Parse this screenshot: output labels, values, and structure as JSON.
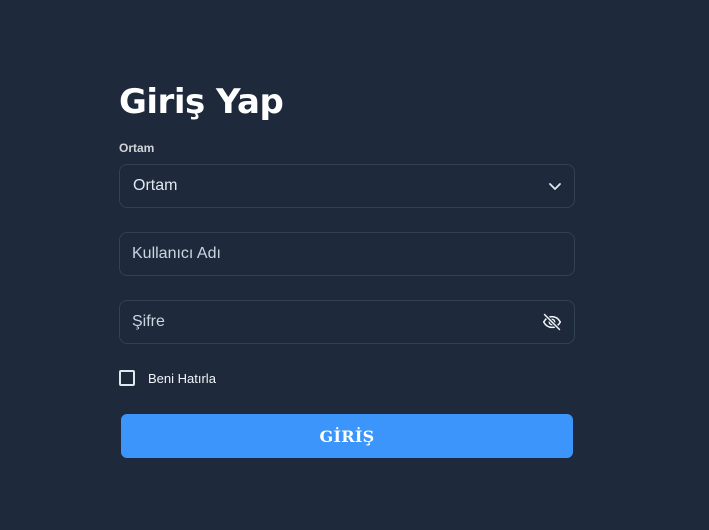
{
  "login": {
    "title": "Giriş Yap",
    "environment_label": "Ortam",
    "environment_value": "Ortam",
    "environment_icon": "chevron-down-icon",
    "username_placeholder": "Kullanıcı Adı",
    "password_placeholder": "Şifre",
    "password_toggle_icon": "eye-off-icon",
    "remember_label": "Beni Hatırla",
    "remember_checked": false,
    "submit_label": "GİRİŞ"
  },
  "colors": {
    "background": "#1e293b",
    "border": "#334155",
    "accent": "#3b95fb",
    "text": "#e2e8f0"
  }
}
